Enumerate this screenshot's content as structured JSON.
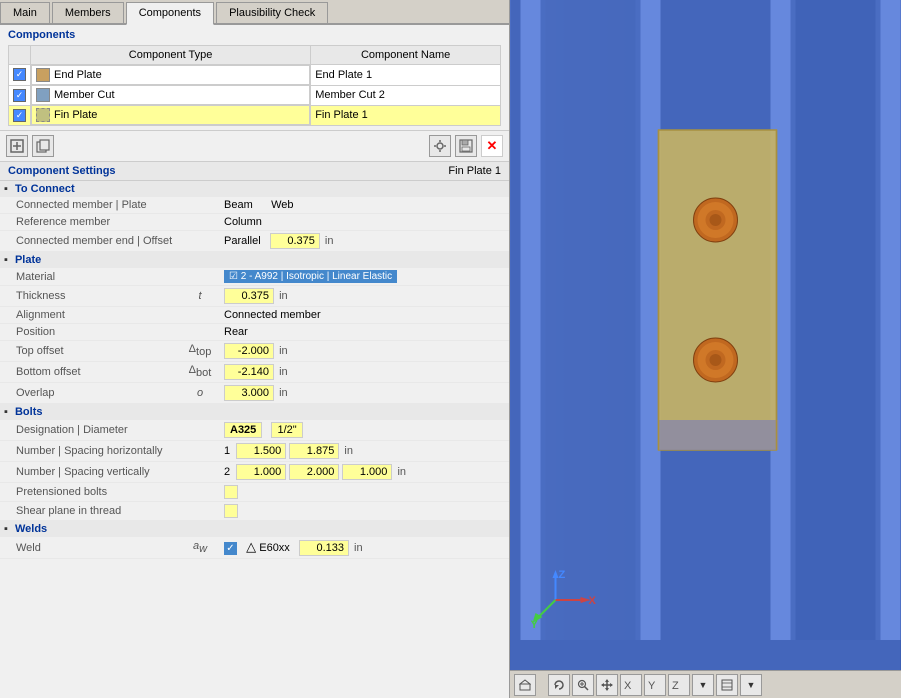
{
  "tabs": [
    {
      "label": "Main",
      "active": false
    },
    {
      "label": "Members",
      "active": false
    },
    {
      "label": "Components",
      "active": true
    },
    {
      "label": "Plausibility Check",
      "active": false
    }
  ],
  "components_section": {
    "title": "Components",
    "columns": [
      "Component Type",
      "Component Name"
    ],
    "rows": [
      {
        "checked": true,
        "type": "End Plate",
        "name": "End Plate 1",
        "selected": false
      },
      {
        "checked": true,
        "type": "Member Cut",
        "name": "Member Cut 2",
        "selected": false
      },
      {
        "checked": true,
        "type": "Fin Plate",
        "name": "Fin Plate 1",
        "selected": true
      }
    ]
  },
  "toolbar_buttons": [
    {
      "label": "⬛",
      "name": "add-component"
    },
    {
      "label": "⬜",
      "name": "copy-component"
    },
    {
      "label": "✎",
      "name": "edit-component"
    },
    {
      "label": "💾",
      "name": "save-component"
    },
    {
      "label": "✕",
      "name": "delete-component",
      "color": "red"
    }
  ],
  "settings": {
    "title": "Component Settings",
    "subtitle": "Fin Plate 1",
    "groups": [
      {
        "label": "To Connect",
        "expanded": true,
        "rows": [
          {
            "label": "Connected member | Plate",
            "symbol": "",
            "values": [
              {
                "text": "Beam",
                "type": "text"
              },
              {
                "text": "Web",
                "type": "text"
              }
            ]
          },
          {
            "label": "Reference member",
            "symbol": "",
            "values": [
              {
                "text": "Column",
                "type": "text"
              }
            ]
          },
          {
            "label": "Connected member end | Offset",
            "symbol": "",
            "values": [
              {
                "text": "Parallel",
                "type": "text"
              },
              {
                "text": "0.375",
                "type": "box",
                "unit": "in"
              }
            ]
          }
        ]
      },
      {
        "label": "Plate",
        "expanded": true,
        "rows": [
          {
            "label": "Material",
            "symbol": "",
            "values": [
              {
                "text": "☑ 2 - A992 | Isotropic | Linear Elastic",
                "type": "material"
              }
            ]
          },
          {
            "label": "Thickness",
            "symbol": "t",
            "values": [
              {
                "text": "0.375",
                "type": "box",
                "unit": "in"
              }
            ]
          },
          {
            "label": "Alignment",
            "symbol": "",
            "values": [
              {
                "text": "Connected member",
                "type": "text"
              }
            ]
          },
          {
            "label": "Position",
            "symbol": "",
            "values": [
              {
                "text": "Rear",
                "type": "text"
              }
            ]
          },
          {
            "label": "Top offset",
            "symbol": "Δtop",
            "values": [
              {
                "text": "-2.000",
                "type": "box",
                "unit": "in"
              }
            ]
          },
          {
            "label": "Bottom offset",
            "symbol": "Δbot",
            "values": [
              {
                "text": "-2.140",
                "type": "box",
                "unit": "in"
              }
            ]
          },
          {
            "label": "Overlap",
            "symbol": "o",
            "values": [
              {
                "text": "3.000",
                "type": "box",
                "unit": "in"
              }
            ]
          }
        ]
      },
      {
        "label": "Bolts",
        "expanded": true,
        "rows": [
          {
            "label": "Designation | Diameter",
            "symbol": "",
            "values": [
              {
                "text": "A325",
                "type": "bolt-label"
              },
              {
                "text": "1/2\"",
                "type": "bolt-diam"
              }
            ]
          },
          {
            "label": "Number | Spacing horizontally",
            "symbol": "",
            "values": [
              {
                "text": "1",
                "type": "text"
              },
              {
                "text": "1.500",
                "type": "box"
              },
              {
                "text": "1.875",
                "type": "box"
              },
              {
                "text": "in",
                "type": "unit"
              }
            ]
          },
          {
            "label": "Number | Spacing vertically",
            "symbol": "",
            "values": [
              {
                "text": "2",
                "type": "text"
              },
              {
                "text": "1.000",
                "type": "box"
              },
              {
                "text": "2.000",
                "type": "box"
              },
              {
                "text": "1.000",
                "type": "box"
              },
              {
                "text": "in",
                "type": "unit"
              }
            ]
          },
          {
            "label": "Pretensioned bolts",
            "symbol": "",
            "values": [
              {
                "text": "",
                "type": "checkbox"
              }
            ]
          },
          {
            "label": "Shear plane in thread",
            "symbol": "",
            "values": [
              {
                "text": "",
                "type": "checkbox-yellow"
              }
            ]
          }
        ]
      },
      {
        "label": "Welds",
        "expanded": true,
        "rows": [
          {
            "label": "Weld",
            "symbol": "aw",
            "values": [
              {
                "text": "☑",
                "type": "checkbox-blue"
              },
              {
                "text": "△",
                "type": "weld-icon"
              },
              {
                "text": "E60xx",
                "type": "text"
              },
              {
                "text": "0.133",
                "type": "box",
                "unit": "in"
              }
            ]
          }
        ]
      }
    ]
  },
  "viewport": {
    "axis": {
      "x_label": "X",
      "y_label": "Y",
      "z_label": "Z"
    }
  }
}
